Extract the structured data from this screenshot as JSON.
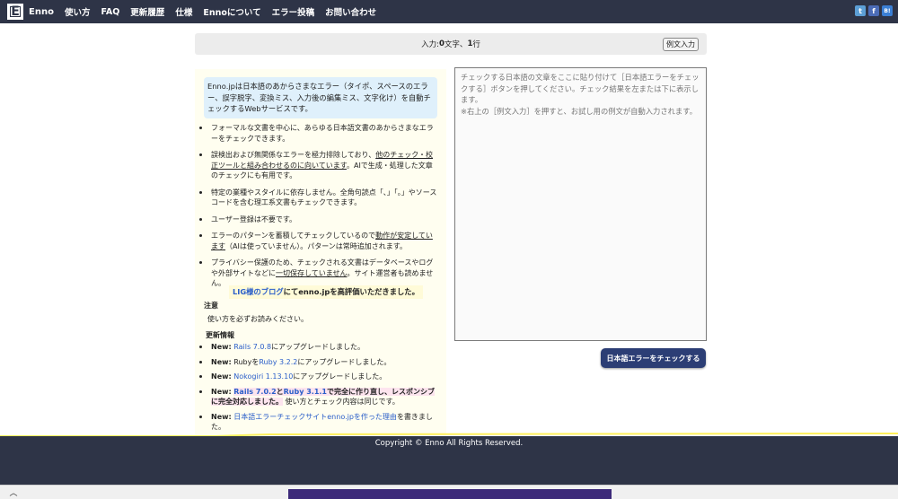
{
  "nav": {
    "logo_letter": "E",
    "brand": "Enno",
    "items": [
      "使い方",
      "FAQ",
      "更新履歴",
      "仕様",
      "Ennoについて",
      "エラー投稿",
      "お問い合わせ"
    ]
  },
  "share": {
    "twitter": "t",
    "facebook": "f",
    "hatena": "B!"
  },
  "counter": {
    "prefix": "入力: ",
    "chars": "0",
    "chars_unit": "文字、",
    "lines": "1",
    "lines_unit": "行",
    "example_button": "例文入力"
  },
  "intro": "Enno.jpは日本語のあからさまなエラー（タイポ、スペースのエラー、誤字脱字、変換ミス、入力後の編集ミス、文字化け）を自動チェックするWebサービスです。",
  "features": [
    {
      "text": "フォーマルな文書を中心に、あらゆる日本語文書のあからさまなエラーをチェックできます。"
    },
    {
      "pre": "誤検出および無関係なエラーを極力排除しており、",
      "underline": "他のチェック・校正ツールと組み合わせるのに向いています",
      "post": "。AIで生成・処理した文章のチェックにも有用です。"
    },
    {
      "text": "特定の業種やスタイルに依存しません。全角句読点「、」「。」やソースコードを含む理工系文書もチェックできます。"
    },
    {
      "text": "ユーザー登録は不要です。"
    },
    {
      "pre": "エラーのパターンを蓄積してチェックしているので",
      "underline": "動作が安定しています",
      "post": "（AIは使っていません）。パターンは常時追加されます。"
    },
    {
      "pre": "プライバシー保護のため、チェックされる文書はデータベースやログや外部サイトなどに",
      "underline": "一切保存していません",
      "post": "。サイト運営者も読めません。"
    }
  ],
  "lig": {
    "link": "LIG様のブログ",
    "text": "にてenno.jpを高評価いただきました。"
  },
  "notice": {
    "heading": "注意",
    "text": "使い方を必ずお読みください。"
  },
  "updates": {
    "heading": "更新情報",
    "new_label": "New:",
    "items": [
      {
        "link": "Rails 7.0.8",
        "text": "にアップグレードしました。"
      },
      {
        "pre": "Rubyを",
        "link": "Ruby 3.2.2",
        "text": "にアップグレードしました。"
      },
      {
        "link": "Nokogiri 1.13.10",
        "text": "にアップグレードしました。"
      },
      {
        "link": "Rails 7.0.2",
        "mid": "と",
        "link2": "Ruby 3.1.1",
        "bold": "で完全に作り直し、レスポンシブに完全対応しました。",
        "text": "使い方とチェック内容は同じです。"
      },
      {
        "link": "日本語エラーチェックサイトenno.jpを作った理由",
        "text": "を書きました。"
      }
    ]
  },
  "input": {
    "placeholder": "チェックする日本語の文章をここに貼り付けて［日本語エラーをチェックする］ボタンを押してください。チェック結果を左または下に表示します。\n※右上の［例文入力］を押すと、お試し用の例文が自動入力されます。"
  },
  "check_button": "日本語エラーをチェックする",
  "footer": "Copyright © Enno All Rights Reserved.",
  "colors": {
    "navbar": "#2e3447",
    "accent_button": "#2c3e75",
    "link": "#2a5ec9",
    "intro_bg": "#dff0fb"
  }
}
